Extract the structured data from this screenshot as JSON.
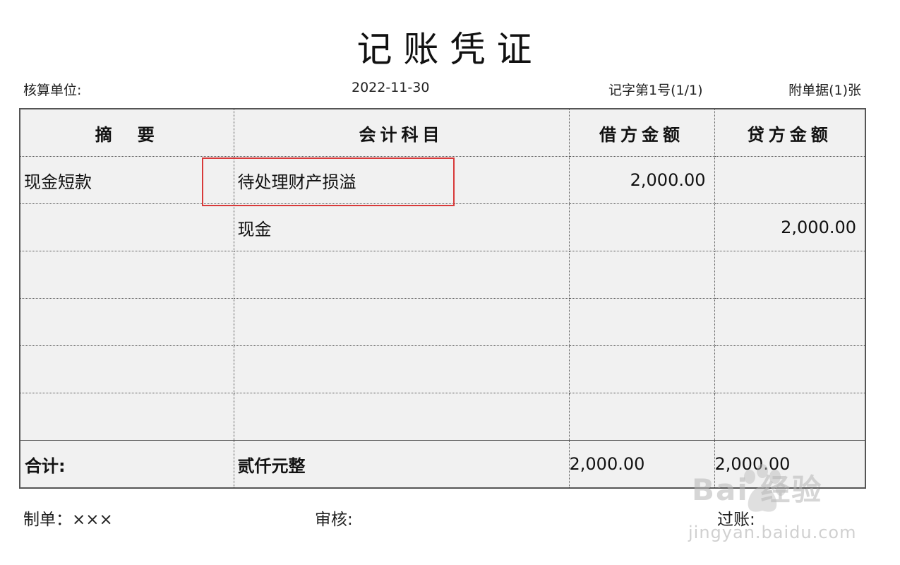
{
  "title": "记账凭证",
  "header": {
    "unit_label": "核算单位:",
    "date": "2022-11-30",
    "voucher_no": "记字第1号(1/1)",
    "attachments": "附单据(1)张"
  },
  "columns": [
    "摘　要",
    "会计科目",
    "借方金额",
    "贷方金额"
  ],
  "rows": [
    {
      "summary": "现金短款",
      "account": "待处理财产损溢",
      "debit": "2,000.00",
      "credit": ""
    },
    {
      "summary": "",
      "account": "现金",
      "debit": "",
      "credit": "2,000.00"
    },
    {
      "summary": "",
      "account": "",
      "debit": "",
      "credit": ""
    },
    {
      "summary": "",
      "account": "",
      "debit": "",
      "credit": ""
    },
    {
      "summary": "",
      "account": "",
      "debit": "",
      "credit": ""
    },
    {
      "summary": "",
      "account": "",
      "debit": "",
      "credit": ""
    }
  ],
  "totals": {
    "label": "合计:",
    "amount_words": "贰仟元整",
    "debit": "2,000.00",
    "credit": "2,000.00"
  },
  "footer": {
    "preparer": "制单：×××",
    "reviewer": "审核:",
    "poster": "过账:"
  },
  "watermark": {
    "logo": "Bai 经验",
    "url": "jingyan.baidu.com"
  },
  "colors": {
    "highlight": "#d83a3a",
    "cell_bg": "#f1f1f1"
  }
}
